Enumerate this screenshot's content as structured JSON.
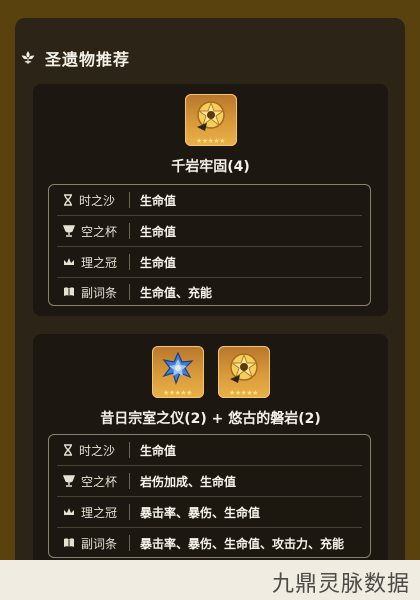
{
  "header": {
    "title": "圣遗物推荐"
  },
  "cards": [
    {
      "set_name": "千岩牢固(4)",
      "icons": [
        "golden-flower-artifact-icon"
      ],
      "stars": "★★★★★",
      "rows": [
        {
          "slot": "时之沙",
          "icon": "hourglass-icon",
          "value": "生命值"
        },
        {
          "slot": "空之杯",
          "icon": "goblet-icon",
          "value": "生命值"
        },
        {
          "slot": "理之冠",
          "icon": "crown-icon",
          "value": "生命值"
        },
        {
          "slot": "副词条",
          "icon": "book-icon",
          "value": "生命值、充能"
        }
      ]
    },
    {
      "set_name": "昔日宗室之仪(2) + 悠古的磐岩(2)",
      "icons": [
        "blue-flower-artifact-icon",
        "golden-flower-artifact-icon"
      ],
      "stars": "★★★★★",
      "rows": [
        {
          "slot": "时之沙",
          "icon": "hourglass-icon",
          "value": "生命值"
        },
        {
          "slot": "空之杯",
          "icon": "goblet-icon",
          "value": "岩伤加成、生命值"
        },
        {
          "slot": "理之冠",
          "icon": "crown-icon",
          "value": "暴击率、暴伤、生命值"
        },
        {
          "slot": "副词条",
          "icon": "book-icon",
          "value": "暴击率、暴伤、生命值、攻击力、充能"
        }
      ]
    }
  ],
  "watermark": {
    "text": "九鼎灵脉数据"
  },
  "colors": {
    "background": "#5a420f",
    "panel": "#2b2417",
    "card": "#1d1711",
    "icon_gold": "#d99a3a"
  }
}
